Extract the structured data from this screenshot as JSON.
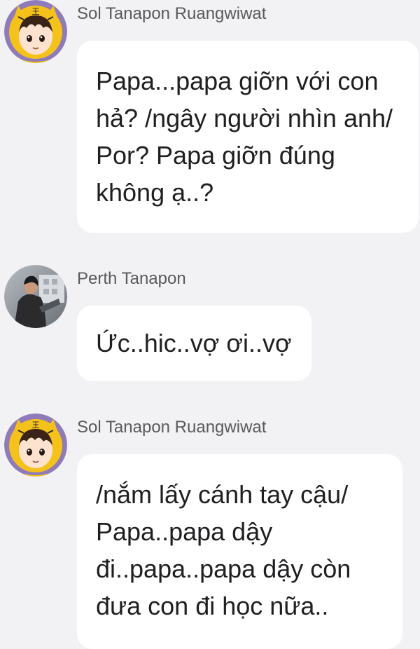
{
  "messages": [
    {
      "sender": "Sol Tanapon Ruangwiwat",
      "avatar": "tiger-hood-boy-avatar",
      "text": "Papa...papa giỡn với con hả? /ngây người nhìn anh/ Por? Papa giỡn đúng không ạ..?"
    },
    {
      "sender": "Perth Tanapon",
      "avatar": "man-photo-avatar",
      "text": "Ức..hic..vợ ơi..vợ"
    },
    {
      "sender": "Sol Tanapon Ruangwiwat",
      "avatar": "tiger-hood-boy-avatar",
      "text": "/nắm lấy cánh tay cậu/ Papa..papa dậy đi..papa..papa dậy còn đưa con đi học nữa.."
    }
  ],
  "colors": {
    "background": "#f2f2f4",
    "bubble": "#ffffff",
    "text": "#1f1f22",
    "sender": "#5a5a5e",
    "avatar_ring": "#8f7bb8",
    "hood": "#f5c21b"
  }
}
